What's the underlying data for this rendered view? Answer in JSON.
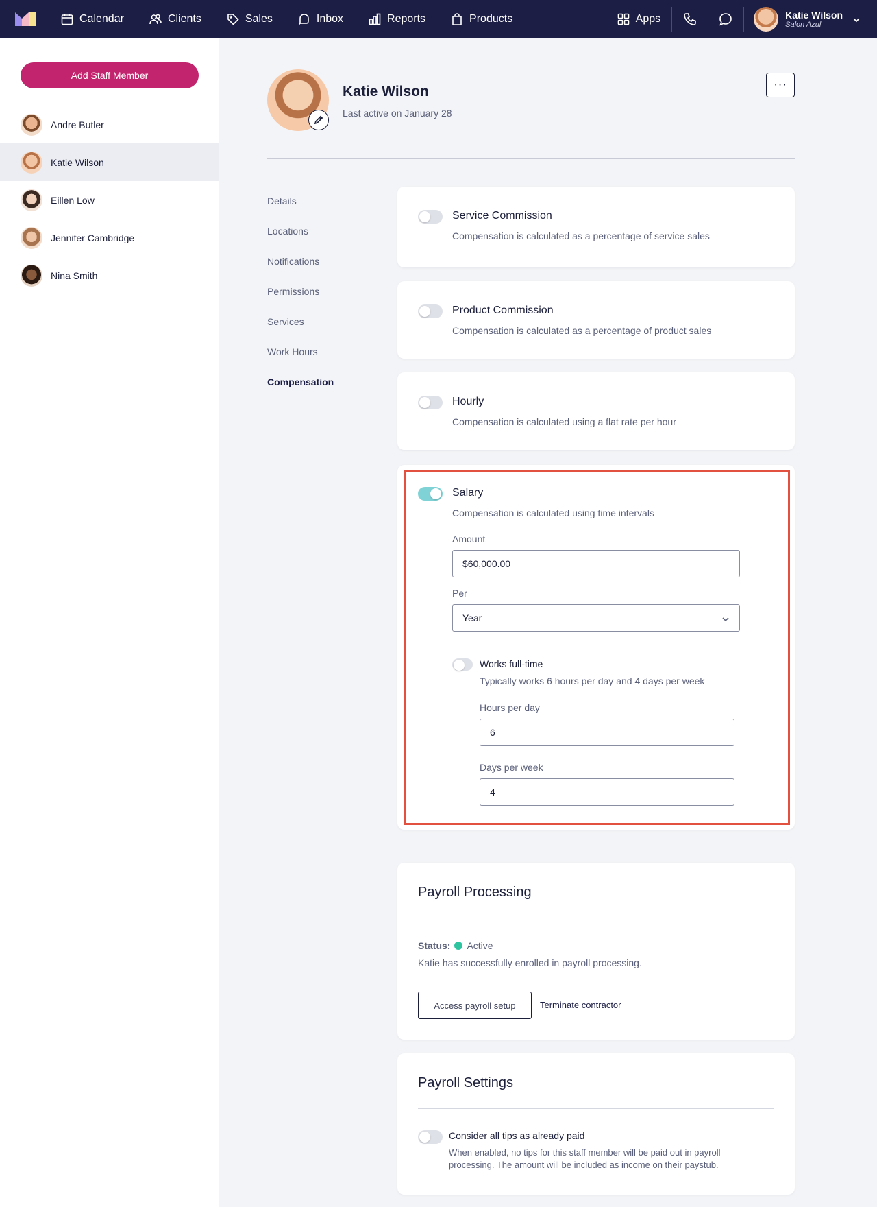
{
  "nav": {
    "items": [
      {
        "label": "Calendar",
        "icon": "calendar-icon"
      },
      {
        "label": "Clients",
        "icon": "users-icon"
      },
      {
        "label": "Sales",
        "icon": "tag-icon"
      },
      {
        "label": "Inbox",
        "icon": "inbox-icon"
      },
      {
        "label": "Reports",
        "icon": "bar-chart-icon"
      },
      {
        "label": "Products",
        "icon": "shopping-bag-icon"
      }
    ],
    "apps_label": "Apps",
    "user": {
      "name": "Katie Wilson",
      "org": "Salon Azul"
    },
    "brand_color": "#1c1e45"
  },
  "sidebar": {
    "add_button": "Add Staff Member",
    "staff": [
      {
        "name": "Andre Butler",
        "active": false
      },
      {
        "name": "Katie Wilson",
        "active": true
      },
      {
        "name": "Eillen Low",
        "active": false
      },
      {
        "name": "Jennifer Cambridge",
        "active": false
      },
      {
        "name": "Nina Smith",
        "active": false
      }
    ],
    "accent_color": "#c2256d"
  },
  "profile": {
    "name": "Katie Wilson",
    "last_active": "Last active on January 28",
    "more_label": "···"
  },
  "subnav": [
    "Details",
    "Locations",
    "Notifications",
    "Permissions",
    "Services",
    "Work Hours",
    "Compensation"
  ],
  "subnav_active": "Compensation",
  "compensation": {
    "service": {
      "title": "Service Commission",
      "desc": "Compensation is calculated as a percentage of service sales",
      "enabled": false
    },
    "product": {
      "title": "Product Commission",
      "desc": "Compensation is calculated as a percentage of product sales",
      "enabled": false
    },
    "hourly": {
      "title": "Hourly",
      "desc": "Compensation is calculated using a flat rate per hour",
      "enabled": false
    },
    "salary": {
      "title": "Salary",
      "desc": "Compensation is calculated using time intervals",
      "enabled": true,
      "amount_label": "Amount",
      "amount_value": "$60,000.00",
      "per_label": "Per",
      "per_value": "Year",
      "fulltime_title": "Works full-time",
      "fulltime_desc": "Typically works 6 hours per day and 4 days per week",
      "fulltime_enabled": false,
      "hours_label": "Hours per day",
      "hours_value": "6",
      "days_label": "Days per week",
      "days_value": "4"
    }
  },
  "payroll_processing": {
    "title": "Payroll Processing",
    "status_label": "Status:",
    "status_value": "Active",
    "status_color": "#2ec4a0",
    "message": "Katie has successfully enrolled in payroll processing.",
    "access_button": "Access payroll setup",
    "terminate_link": "Terminate contractor"
  },
  "payroll_settings": {
    "title": "Payroll Settings",
    "tips_title": "Consider all tips as already paid",
    "tips_desc_line1": "When enabled, no tips for this staff member will be paid out in payroll",
    "tips_desc_line2": "processing. The amount will be included as income on their paystub.",
    "tips_enabled": false
  }
}
